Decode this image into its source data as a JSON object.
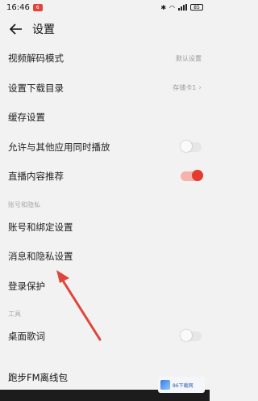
{
  "status_bar": {
    "time": "16:46",
    "notification_badge": "6",
    "battery": "85"
  },
  "header": {
    "title": "设置"
  },
  "settings": {
    "video_decode": {
      "label": "视频解码模式",
      "value": "默认设置"
    },
    "download_dir": {
      "label": "设置下载目录",
      "value": "存储卡1"
    },
    "cache": {
      "label": "缓存设置"
    },
    "mix_playback": {
      "label": "允许与其他应用同时播放",
      "enabled": false
    },
    "live_recommend": {
      "label": "直播内容推荐",
      "enabled": true
    },
    "account_section": {
      "label": "账号和隐私"
    },
    "account_binding": {
      "label": "账号和绑定设置"
    },
    "message_privacy": {
      "label": "消息和隐私设置"
    },
    "login_protect": {
      "label": "登录保护"
    },
    "tools_section": {
      "label": "工具"
    },
    "desktop_lyrics": {
      "label": "桌面歌词",
      "enabled": false
    },
    "fm_offline": {
      "label": "跑步FM离线包"
    }
  },
  "watermark": {
    "text": "86下载网"
  },
  "colors": {
    "accent": "#e43b2e",
    "arrow": "#e0453a"
  }
}
